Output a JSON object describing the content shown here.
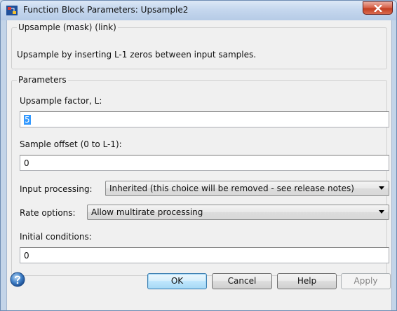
{
  "window": {
    "title": "Function Block Parameters: Upsample2"
  },
  "mask": {
    "group_title": "Upsample (mask) (link)",
    "description": "Upsample by inserting L-1 zeros between input samples."
  },
  "parameters": {
    "group_title": "Parameters",
    "upsample_factor": {
      "label": "Upsample factor, L:",
      "value": "5"
    },
    "sample_offset": {
      "label": "Sample offset (0 to L-1):",
      "value": "0"
    },
    "input_processing": {
      "label": "Input processing:",
      "selected": "Inherited (this choice will be removed - see release notes)"
    },
    "rate_options": {
      "label": "Rate options:",
      "selected": "Allow multirate processing"
    },
    "initial_conditions": {
      "label": "Initial conditions:",
      "value": "0"
    }
  },
  "buttons": {
    "ok": "OK",
    "cancel": "Cancel",
    "help": "Help",
    "apply": "Apply"
  },
  "icons": {
    "app": "simulink-block-icon",
    "close": "close-icon",
    "help": "help-circle-icon"
  },
  "colors": {
    "titlebar": "#c5d7ee",
    "close_button": "#c33f22",
    "selection": "#3399ff",
    "dialog_bg": "#f0f0f0"
  }
}
